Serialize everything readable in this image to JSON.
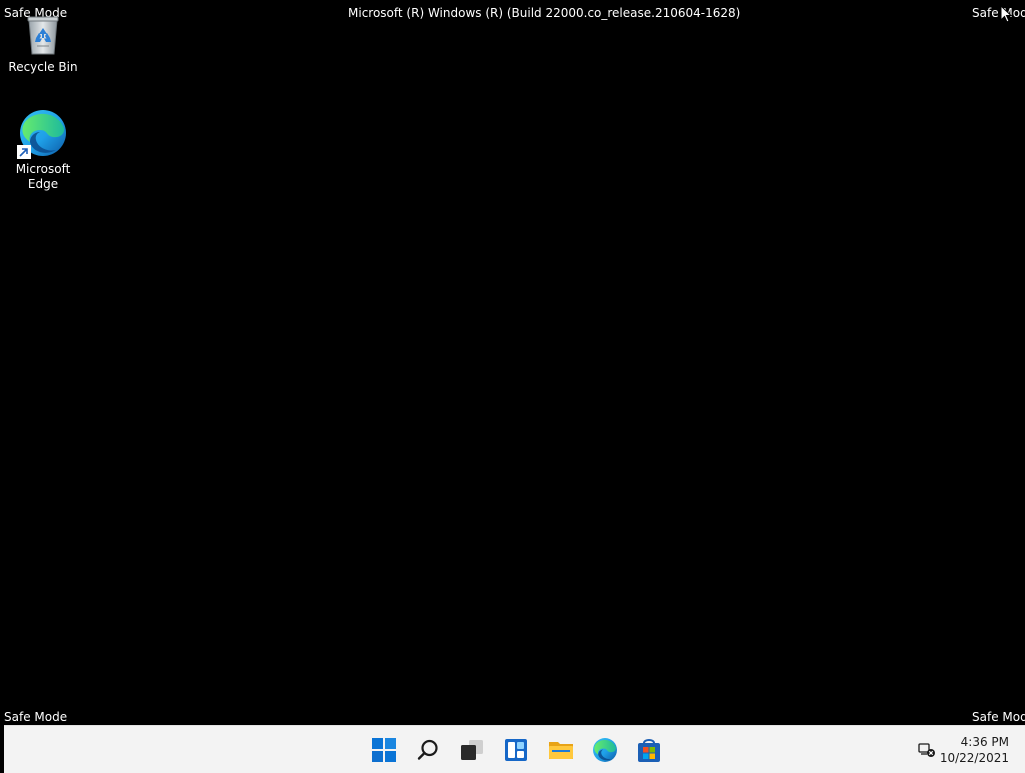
{
  "watermarks": {
    "top_left": "Safe Mode",
    "top_right": "Safe Mode",
    "bottom_left": "Safe Mode",
    "bottom_right": "Safe Mode",
    "build_title": "Microsoft (R) Windows (R) (Build 22000.co_release.210604-1628)"
  },
  "desktop_icons": [
    {
      "label": "Recycle Bin",
      "icon": "recycle-bin-icon"
    },
    {
      "label": "Microsoft Edge",
      "icon": "edge-icon",
      "shortcut": true
    }
  ],
  "taskbar": {
    "apps": [
      {
        "name": "Start",
        "icon": "windows-start-icon"
      },
      {
        "name": "Search",
        "icon": "search-icon"
      },
      {
        "name": "Task View",
        "icon": "task-view-icon"
      },
      {
        "name": "Widgets",
        "icon": "widgets-icon"
      },
      {
        "name": "File Explorer",
        "icon": "folder-icon"
      },
      {
        "name": "Microsoft Edge",
        "icon": "edge-icon"
      },
      {
        "name": "Microsoft Store",
        "icon": "store-icon"
      }
    ],
    "tray": {
      "network_icon": "network-disconnected-icon",
      "time": "4:36 PM",
      "date": "10/22/2021"
    }
  },
  "colors": {
    "desktop_bg": "#000000",
    "taskbar_bg": "#f3f3f3",
    "windows_blue": "#0078d4"
  }
}
